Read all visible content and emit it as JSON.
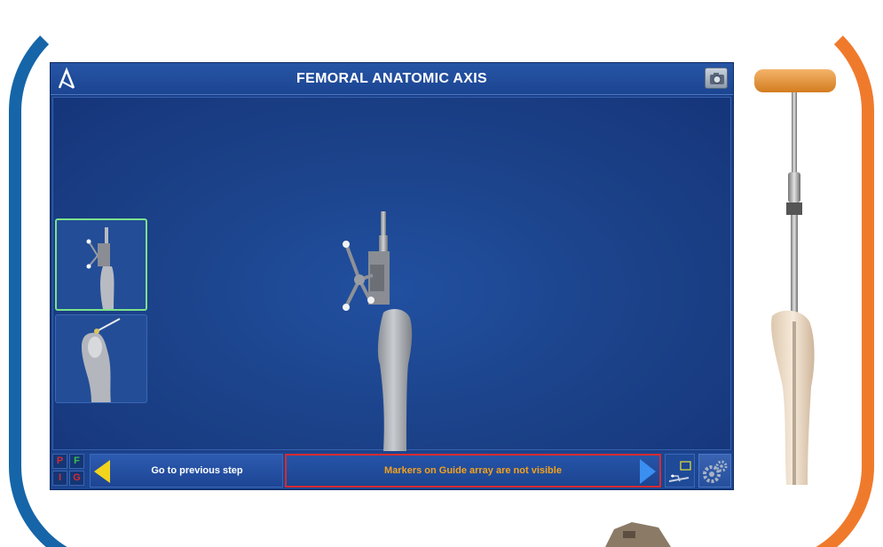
{
  "window": {
    "title": "FEMORAL ANATOMIC AXIS"
  },
  "status_bar": {
    "indicators": [
      {
        "letter": "P",
        "color": "#d62b30"
      },
      {
        "letter": "F",
        "color": "#39c24a"
      },
      {
        "letter": "I",
        "color": "#d62b30"
      },
      {
        "letter": "G",
        "color": "#d62b30"
      }
    ],
    "previous_step_label": "Go to previous step",
    "message": "Markers on Guide array are not visible"
  },
  "colors": {
    "accent_left": "#1565a8",
    "accent_right": "#f07a2c",
    "panel": "#1b3f86",
    "warning_text": "#f5a21c",
    "warning_border": "#d62b30",
    "active_thumb_border": "#7be38a"
  },
  "icons": [
    "logo-icon",
    "camera-icon",
    "prev-arrow-icon",
    "next-arrow-icon",
    "navigation-icon",
    "gears-icon"
  ]
}
